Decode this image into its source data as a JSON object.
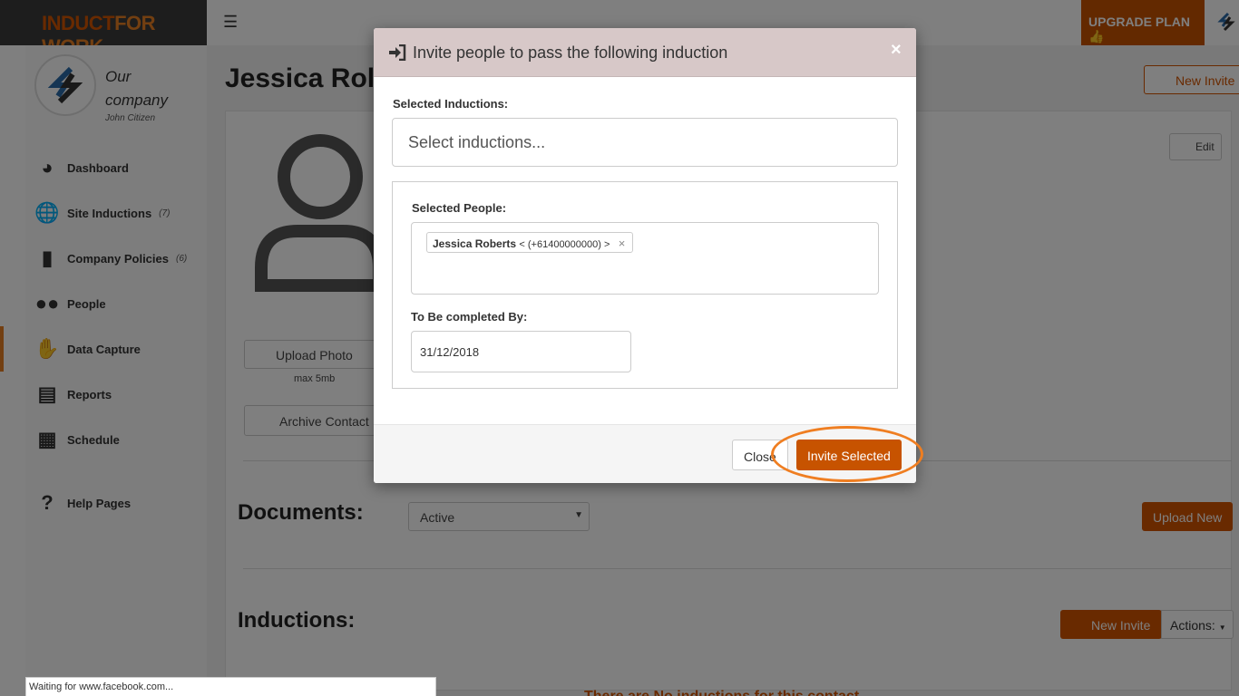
{
  "app": {
    "logo_part1": "INDUCT",
    "logo_part2": "FOR WORK",
    "upgrade_label": "UPGRADE PLAN"
  },
  "sidebar": {
    "company_name_line1": "Our",
    "company_name_line2": "company",
    "user_name": "John Citizen",
    "items": [
      {
        "label": "Dashboard",
        "count": ""
      },
      {
        "label": "Site Inductions",
        "count": "(7)"
      },
      {
        "label": "Company Policies",
        "count": "(6)"
      },
      {
        "label": "People",
        "count": ""
      },
      {
        "label": "Data Capture",
        "count": ""
      },
      {
        "label": "Reports",
        "count": ""
      },
      {
        "label": "Schedule",
        "count": ""
      },
      {
        "label": "Help Pages",
        "count": ""
      }
    ]
  },
  "main": {
    "title": "Jessica Rol",
    "new_invite_label": "New Invite",
    "edit_label": "Edit",
    "upload_photo_label": "Upload Photo",
    "max_size": "max 5mb",
    "archive_label": "Archive Contact",
    "documents_title": "Documents:",
    "documents_filter": "Active",
    "upload_new_label": "Upload New",
    "inductions_title": "Inductions:",
    "new_invite2_label": "New Invite",
    "actions_label": "Actions:",
    "no_inductions": "There are No inductions for this contact"
  },
  "modal": {
    "title": "Invite people to pass the following induction",
    "close_x": "×",
    "selected_inductions_label": "Selected Inductions:",
    "inductions_placeholder": "Select inductions...",
    "selected_people_label": "Selected People:",
    "person_name": "Jessica Roberts",
    "person_phone": "< (+61400000000) >",
    "tag_remove": "×",
    "completed_by_label": "To Be completed By:",
    "completed_by_value": "31/12/2018",
    "close_label": "Close",
    "invite_label": "Invite Selected"
  },
  "statusbar": {
    "text": "Waiting for www.facebook.com..."
  },
  "colors": {
    "brand_orange": "#d35400",
    "invite_button": "#c75300",
    "highlight_ring": "#ef7e21",
    "modal_header": "#d7c8c8"
  },
  "icons": [
    "bars-icon",
    "dashboard-icon",
    "globe-icon",
    "book-icon",
    "users-icon",
    "hand-icon",
    "bar-chart-icon",
    "calendar-icon",
    "question-icon",
    "sign-in-icon",
    "paper-plane-icon",
    "pencil-icon",
    "archive-icon",
    "thumbs-up-icon"
  ]
}
